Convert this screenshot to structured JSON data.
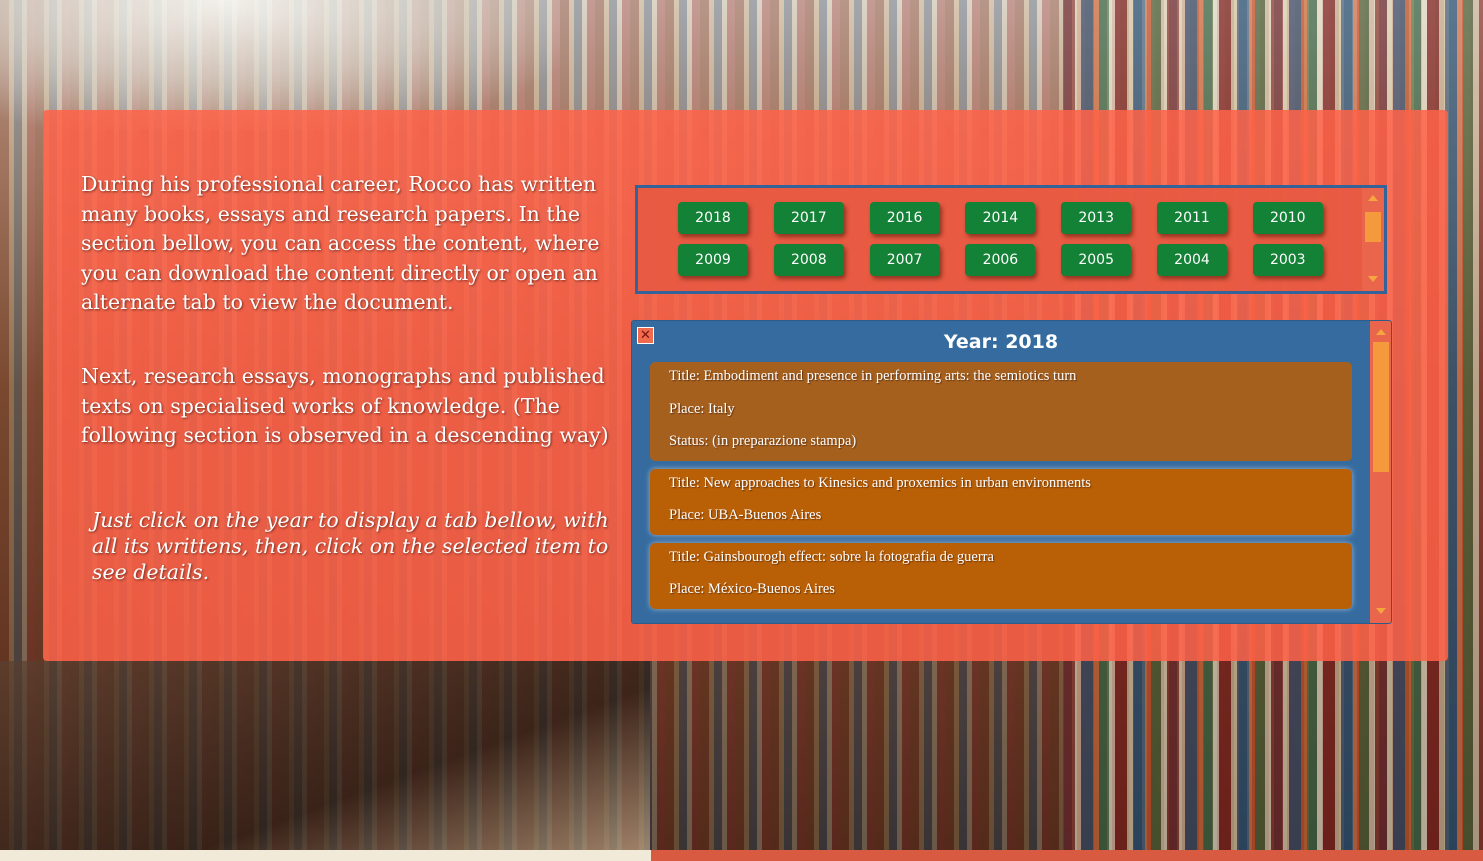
{
  "intro": {
    "paragraph1": "During his professional career, Rocco has written many books, essays and research papers. In the section bellow, you can access the content, where you can download the content directly or open an alternate tab to view the document.",
    "paragraph2": "Next, research essays, monographs and published texts on specialised works of knowledge. (The following section is observed in a descending way)",
    "hint": "Just click on the year to display a tab bellow, with all its writtens, then, click on the selected item to see details."
  },
  "years": [
    "2018",
    "2017",
    "2016",
    "2014",
    "2013",
    "2011",
    "2010",
    "2009",
    "2008",
    "2007",
    "2006",
    "2005",
    "2004",
    "2003"
  ],
  "details": {
    "close_icon": "x-icon",
    "title": "Year: 2018",
    "entries": [
      {
        "title": "Title: Embodiment and presence in performing arts: the semiotics turn",
        "place": "Place: Italy",
        "status": "Status: (in preparazione stampa)"
      },
      {
        "title": "Title: New approaches to Kinesics and proxemics in urban environments",
        "place": "Place: UBA-Buenos Aires"
      },
      {
        "title": "Title: Gainsbourogh effect: sobre la fotografia de guerra",
        "place": "Place: México-Buenos Aires"
      }
    ]
  },
  "colors": {
    "panel": "#ff6248",
    "year_button": "#138136",
    "details_bg": "#356b9f",
    "entry_bg": "#b36217",
    "scroll_thumb": "#f59a3c"
  }
}
